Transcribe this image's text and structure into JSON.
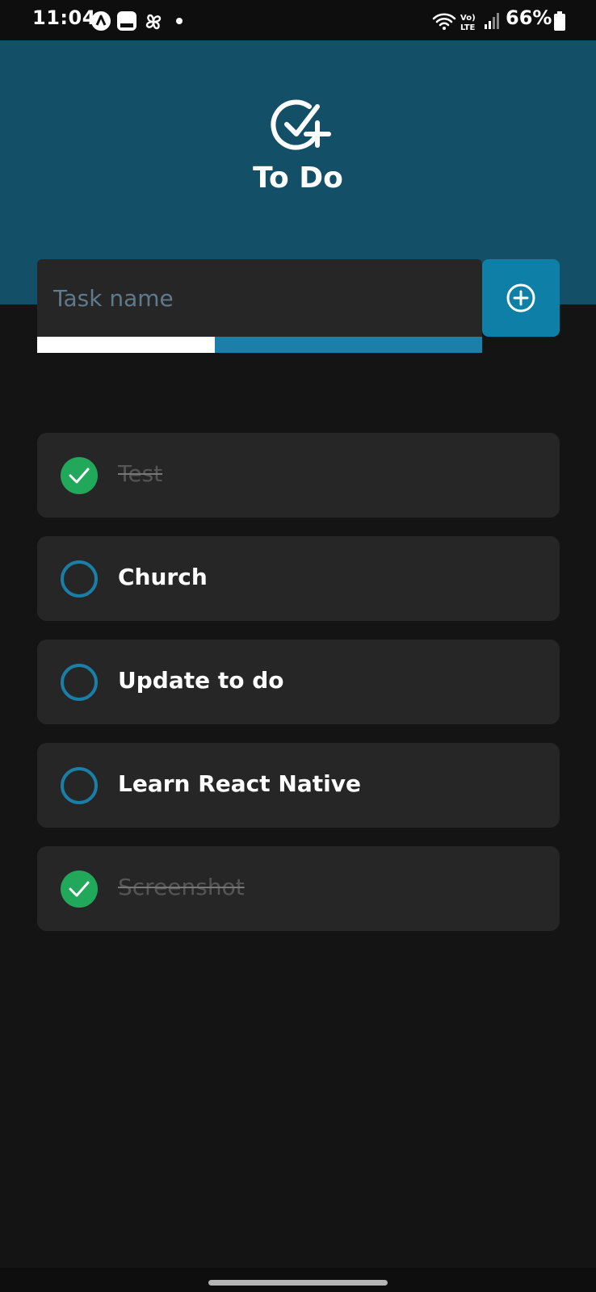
{
  "status_bar": {
    "time": "11:04",
    "battery_percent": "66%",
    "icons": [
      "app-a-icon",
      "app-b-icon",
      "pinwheel-icon",
      "dot-icon",
      "wifi-icon",
      "volte-icon",
      "signal-icon",
      "battery-icon"
    ]
  },
  "header": {
    "title": "To Do",
    "logo_icon": "check-circle-plus-icon",
    "background_color": "#135068"
  },
  "task_input": {
    "placeholder": "Task name",
    "value": "",
    "add_icon": "plus-circle-icon",
    "accent_color": "#0e7fa6"
  },
  "tasks": [
    {
      "label": "Test",
      "completed": true
    },
    {
      "label": "Church",
      "completed": false
    },
    {
      "label": "Update to do",
      "completed": false
    },
    {
      "label": "Learn React Native",
      "completed": false
    },
    {
      "label": "Screenshot",
      "completed": true
    }
  ],
  "colors": {
    "done": "#22a85a",
    "pending": "#1a7fa6",
    "card": "#262626",
    "background": "#141414"
  }
}
